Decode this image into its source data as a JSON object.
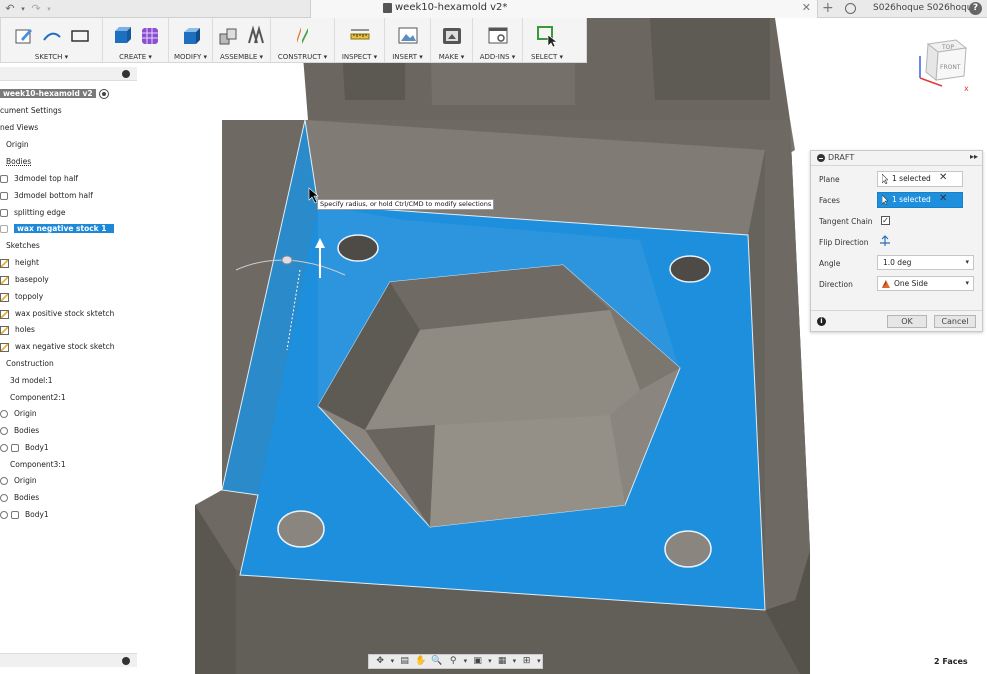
{
  "window": {
    "document_title": "week10-hexamold v2*",
    "user": "S026hoque S026hoque"
  },
  "toolbar": {
    "groups": [
      {
        "label": "SKETCH"
      },
      {
        "label": "CREATE"
      },
      {
        "label": "MODIFY"
      },
      {
        "label": "ASSEMBLE"
      },
      {
        "label": "CONSTRUCT"
      },
      {
        "label": "INSPECT"
      },
      {
        "label": "INSERT"
      },
      {
        "label": "MAKE"
      },
      {
        "label": "ADD-INS"
      },
      {
        "label": "SELECT"
      }
    ]
  },
  "viewcube": {
    "top": "TOP",
    "front": "FRONT"
  },
  "browser": {
    "root": "week10-hexamold v2",
    "items": [
      {
        "label": "cument Settings"
      },
      {
        "label": "ned Views"
      },
      {
        "label": "Origin"
      },
      {
        "label": "Bodies"
      },
      {
        "label": "3dmodel top half"
      },
      {
        "label": "3dmodel bottom half"
      },
      {
        "label": "splitting edge"
      },
      {
        "label": "wax negative stock 1"
      },
      {
        "label": "Sketches"
      },
      {
        "label": "height"
      },
      {
        "label": "basepoly"
      },
      {
        "label": "toppoly"
      },
      {
        "label": "wax positive stock sktetch"
      },
      {
        "label": "holes"
      },
      {
        "label": "wax negative stock sketch"
      },
      {
        "label": "Construction"
      },
      {
        "label": "3d model:1"
      },
      {
        "label": "Component2:1"
      },
      {
        "label": "Origin"
      },
      {
        "label": "Bodies"
      },
      {
        "label": "Body1"
      },
      {
        "label": "Component3:1"
      },
      {
        "label": "Origin"
      },
      {
        "label": "Bodies"
      },
      {
        "label": "Body1"
      }
    ]
  },
  "tooltip": "Specify radius, or hold Ctrl/CMD to modify selections",
  "draft": {
    "title": "DRAFT",
    "plane_label": "Plane",
    "plane_value": "1 selected",
    "faces_label": "Faces",
    "faces_value": "1 selected",
    "tangent_label": "Tangent Chain",
    "flip_label": "Flip Direction",
    "angle_label": "Angle",
    "angle_value": "1.0 deg",
    "direction_label": "Direction",
    "direction_value": "One Side",
    "ok": "OK",
    "cancel": "Cancel"
  },
  "status": "2 Faces",
  "colors": {
    "selection_blue": "#1e8fdc",
    "body_gray": "#6e6a63",
    "accent": "#1e88d8"
  }
}
